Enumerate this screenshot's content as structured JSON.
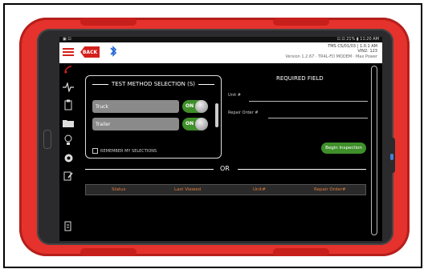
{
  "status_bar": {
    "left": "▣ ⊡",
    "right": "⊡ ⊡ 21% ▮ 11:20 AM"
  },
  "header": {
    "back_label": "BACK",
    "info_line1": "TMS CS/01/03 | 1.0.1 AM",
    "info_line2": "VIN2: 123",
    "version_line": "Version 1.2.67 · TR4L-FD MODEM · Max Power"
  },
  "sidebar": {
    "items": [
      {
        "icon": "menu-icon"
      },
      {
        "icon": "rss-icon"
      },
      {
        "icon": "pulse-icon"
      },
      {
        "icon": "clipboard-icon"
      },
      {
        "icon": "folder-icon"
      },
      {
        "icon": "lightbulb-icon"
      },
      {
        "icon": "gear-icon"
      },
      {
        "icon": "edit-icon"
      },
      {
        "icon": "scan-icon"
      }
    ]
  },
  "test_method": {
    "title": "TEST METHOD SELECTION (S)",
    "options": [
      {
        "label": "Truck",
        "toggle": "ON"
      },
      {
        "label": "Trailer",
        "toggle": "ON"
      }
    ],
    "remember_label": "REMEMBER MY SELECTIONS"
  },
  "required": {
    "title": "REQUIRED FIELD",
    "unit_label": "Unit #",
    "repair_label": "Repair Order #",
    "begin_label": "Begin Inspection"
  },
  "divider": {
    "or_label": "OR"
  },
  "table": {
    "headers": [
      "Status",
      "Last Viewed",
      "Unit#",
      "Repair Order#"
    ]
  },
  "colors": {
    "accent_red": "#d4201c",
    "toggle_green": "#3f8f2a",
    "header_orange": "#e07a3a"
  }
}
